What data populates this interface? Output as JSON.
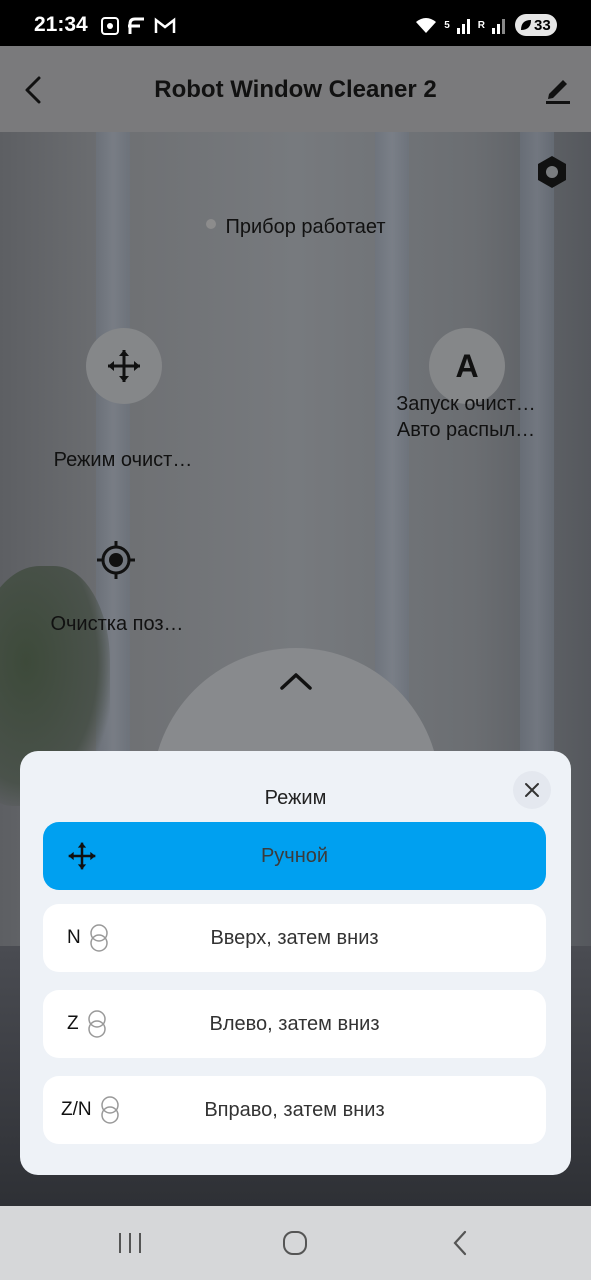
{
  "status_bar": {
    "time": "21:34",
    "battery": "33",
    "signal_labels": [
      "5",
      "R"
    ]
  },
  "header": {
    "title": "Robot Window Cleaner 2",
    "back_icon": "chevron-left-icon",
    "edit_icon": "pencil-icon"
  },
  "device": {
    "status_text": "Прибор работает",
    "features": [
      {
        "label": "Режим очист…",
        "icon": "move-arrows-icon"
      },
      {
        "label_line1": "Запуск очист…",
        "label_line2": "Авто распыл…",
        "icon_text": "A"
      },
      {
        "label": "Очистка поз…",
        "icon": "crosshair-icon"
      }
    ]
  },
  "sheet": {
    "title": "Режим",
    "close_icon": "close-icon",
    "modes": [
      {
        "prefix": "",
        "label": "Ручной",
        "selected": true
      },
      {
        "prefix": "N",
        "label": "Вверх, затем вниз",
        "selected": false
      },
      {
        "prefix": "Z",
        "label": "Влево, затем вниз",
        "selected": false
      },
      {
        "prefix": "Z/N",
        "label": "Вправо, затем вниз",
        "selected": false
      }
    ]
  },
  "colors": {
    "accent": "#00a0f0",
    "sheet_bg": "#eef2f7"
  }
}
